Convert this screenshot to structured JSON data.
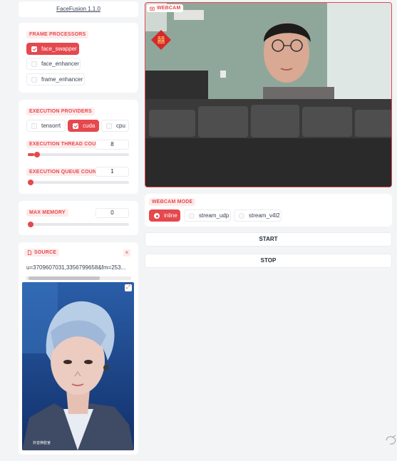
{
  "app": {
    "title": "FaceFusion 1.1.0"
  },
  "frame_processors": {
    "label": "FRAME PROCESSORS",
    "options": [
      {
        "label": "face_swapper",
        "checked": true
      },
      {
        "label": "face_enhancer",
        "checked": false
      },
      {
        "label": "frame_enhancer",
        "checked": false
      }
    ]
  },
  "execution_providers": {
    "label": "EXECUTION PROVIDERS",
    "options": [
      {
        "label": "tensorrt",
        "checked": false
      },
      {
        "label": "cuda",
        "checked": true
      },
      {
        "label": "cpu",
        "checked": false
      }
    ]
  },
  "thread_count": {
    "label": "EXECUTION THREAD COUNT",
    "value": "8",
    "fraction": 0.06
  },
  "queue_count": {
    "label": "EXECUTION QUEUE COUNT",
    "value": "1",
    "fraction": 0.0
  },
  "max_memory": {
    "label": "MAX MEMORY",
    "value": "0",
    "fraction": 0.0
  },
  "source": {
    "label": "SOURCE",
    "filename": "u=3709607031,3356799658&fm=253...",
    "watermark": "抖音换脸官"
  },
  "webcam": {
    "label": "WEBCAM"
  },
  "webcam_mode": {
    "label": "WEBCAM MODE",
    "options": [
      {
        "label": "inline",
        "selected": true
      },
      {
        "label": "stream_udp",
        "selected": false
      },
      {
        "label": "stream_v4l2",
        "selected": false
      }
    ]
  },
  "actions": {
    "start": "START",
    "stop": "STOP"
  },
  "colors": {
    "accent": "#e5484d",
    "background": "#f3f4f6",
    "panel": "#ffffff"
  }
}
